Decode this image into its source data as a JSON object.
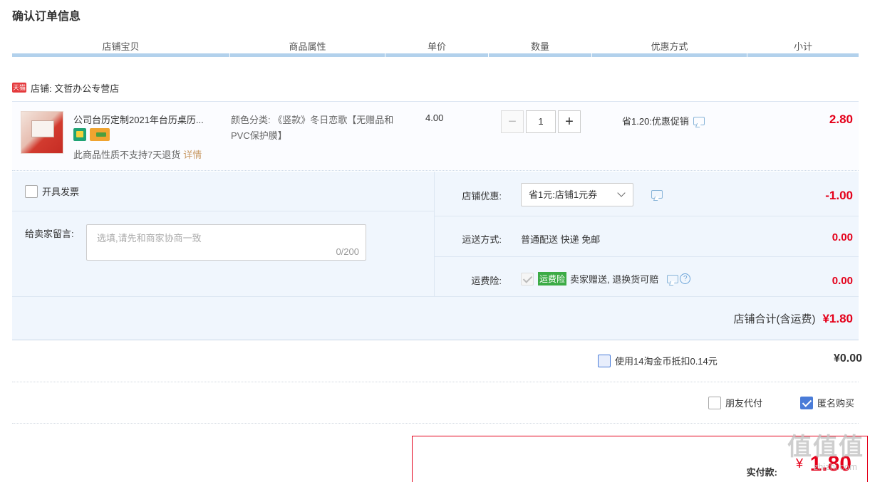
{
  "page_title": "确认订单信息",
  "columns": [
    "店铺宝贝",
    "商品属性",
    "单价",
    "数量",
    "优惠方式",
    "小计"
  ],
  "shop": {
    "badge": "天猫",
    "name": "店铺: 文哲办公专营店"
  },
  "item": {
    "title": "公司台历定制2021年台历桌历...",
    "attr": "颜色分类: 《竖款》冬日恋歌【无赠品和PVC保护膜】",
    "no_return": "此商品性质不支持7天退货",
    "detail_link": "详情",
    "price": "4.00",
    "qty_minus": "−",
    "qty": "1",
    "qty_plus": "+",
    "promo": "省1.20:优惠促销",
    "subtotal": "2.80"
  },
  "options": {
    "invoice_label": "开具发票",
    "memo_label": "给卖家留言:",
    "memo_placeholder": "选填,请先和商家协商一致",
    "memo_count": "0/200",
    "shop_coupon_label": "店铺优惠:",
    "shop_coupon_value": "省1元:店铺1元券",
    "shop_coupon_amount": "-1.00",
    "shipping_label": "运送方式:",
    "shipping_value": "普通配送 快递 免邮",
    "shipping_amount": "0.00",
    "insurance_label": "运费险:",
    "insurance_tag": "运费险",
    "insurance_text": "卖家赠送, 退换货可赔",
    "insurance_help": "?",
    "insurance_amount": "0.00",
    "shop_total_label": "店铺合计(含运费)",
    "shop_total_value": "¥1.80"
  },
  "taobao_coin": {
    "label": "使用14淘金币抵扣0.14元",
    "amount": "¥0.00"
  },
  "friend_pay": "朋友代付",
  "anonymous": "匿名购买",
  "pay": {
    "label": "实付款:",
    "yen": "¥",
    "value": "1.80"
  },
  "watermark": {
    "text": "值值值",
    "sub": "zhizhi.com"
  },
  "colors": {
    "accent_red": "#e4001a",
    "header_line": "#b2d1ec",
    "panel_bg": "#f0f6fd",
    "check_blue": "#4a7cd8"
  }
}
